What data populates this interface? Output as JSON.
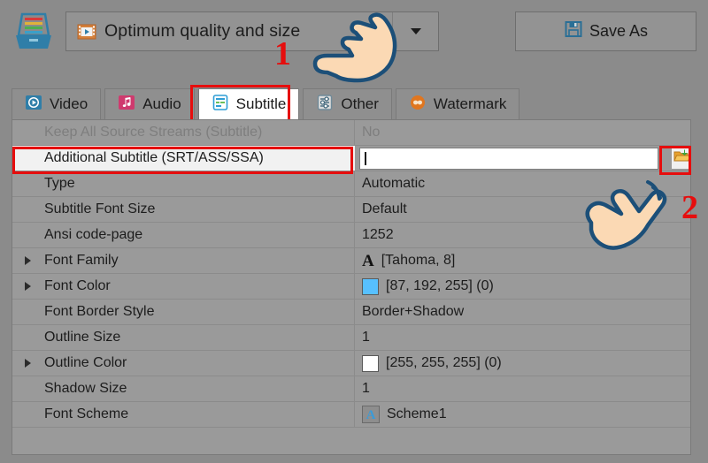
{
  "toolbar": {
    "app_logo_icon": "inbox-tray-icon",
    "preset": {
      "icon": "film-strip-icon",
      "value": "Optimum quality and size",
      "dropdown_icon": "chevron-down-icon"
    },
    "save_as": {
      "label": "Save As",
      "icon": "floppy-disk-icon"
    }
  },
  "tabs": [
    {
      "label": "Video",
      "icon": "video-play-icon",
      "active": false
    },
    {
      "label": "Audio",
      "icon": "music-note-icon",
      "active": false
    },
    {
      "label": "Subtitle",
      "icon": "subtitle-list-icon",
      "active": true
    },
    {
      "label": "Other",
      "icon": "sliders-icon",
      "active": false
    },
    {
      "label": "Watermark",
      "icon": "watermark-icon",
      "active": false
    }
  ],
  "properties": [
    {
      "name": "Keep All Source Streams (Subtitle)",
      "value": "No",
      "disabled": true,
      "expandable": false,
      "kind": "text"
    },
    {
      "name": "Additional Subtitle (SRT/ASS/SSA)",
      "value": "",
      "disabled": false,
      "expandable": false,
      "kind": "input",
      "placeholder": "",
      "browse_icon": "open-folder-icon"
    },
    {
      "name": "Type",
      "value": "Automatic",
      "disabled": false,
      "expandable": false,
      "kind": "text"
    },
    {
      "name": "Subtitle Font Size",
      "value": "Default",
      "disabled": false,
      "expandable": false,
      "kind": "text"
    },
    {
      "name": "Ansi code-page",
      "value": "1252",
      "disabled": false,
      "expandable": false,
      "kind": "text"
    },
    {
      "name": "Font Family",
      "value": "[Tahoma, 8]",
      "disabled": false,
      "expandable": true,
      "kind": "font",
      "icon": "font-letter-a-icon"
    },
    {
      "name": "Font Color",
      "value": "[87, 192, 255] (0)",
      "disabled": false,
      "expandable": true,
      "kind": "color",
      "swatch": "#57c0ff"
    },
    {
      "name": "Font Border Style",
      "value": "Border+Shadow",
      "disabled": false,
      "expandable": false,
      "kind": "text"
    },
    {
      "name": "Outline Size",
      "value": "1",
      "disabled": false,
      "expandable": false,
      "kind": "text"
    },
    {
      "name": "Outline Color",
      "value": "[255, 255, 255] (0)",
      "disabled": false,
      "expandable": true,
      "kind": "color",
      "swatch": "#ffffff"
    },
    {
      "name": "Shadow Size",
      "value": "1",
      "disabled": false,
      "expandable": false,
      "kind": "text"
    },
    {
      "name": "Font Scheme",
      "value": "Scheme1",
      "disabled": false,
      "expandable": false,
      "kind": "scheme",
      "icon": "scheme-letter-a-icon"
    }
  ],
  "annotations": [
    {
      "label": "1",
      "target": "preset-dropdown",
      "cursor": "hand-pointing-down-left-icon"
    },
    {
      "label": "2",
      "target": "browse-folder-button",
      "cursor": "hand-pointing-up-right-icon"
    }
  ],
  "colors": {
    "highlight_red": "#e60d0d",
    "panel_bg": "#9a9a9a",
    "window_bg": "#8b8b8b",
    "accent_blue": "#2a5d86"
  }
}
